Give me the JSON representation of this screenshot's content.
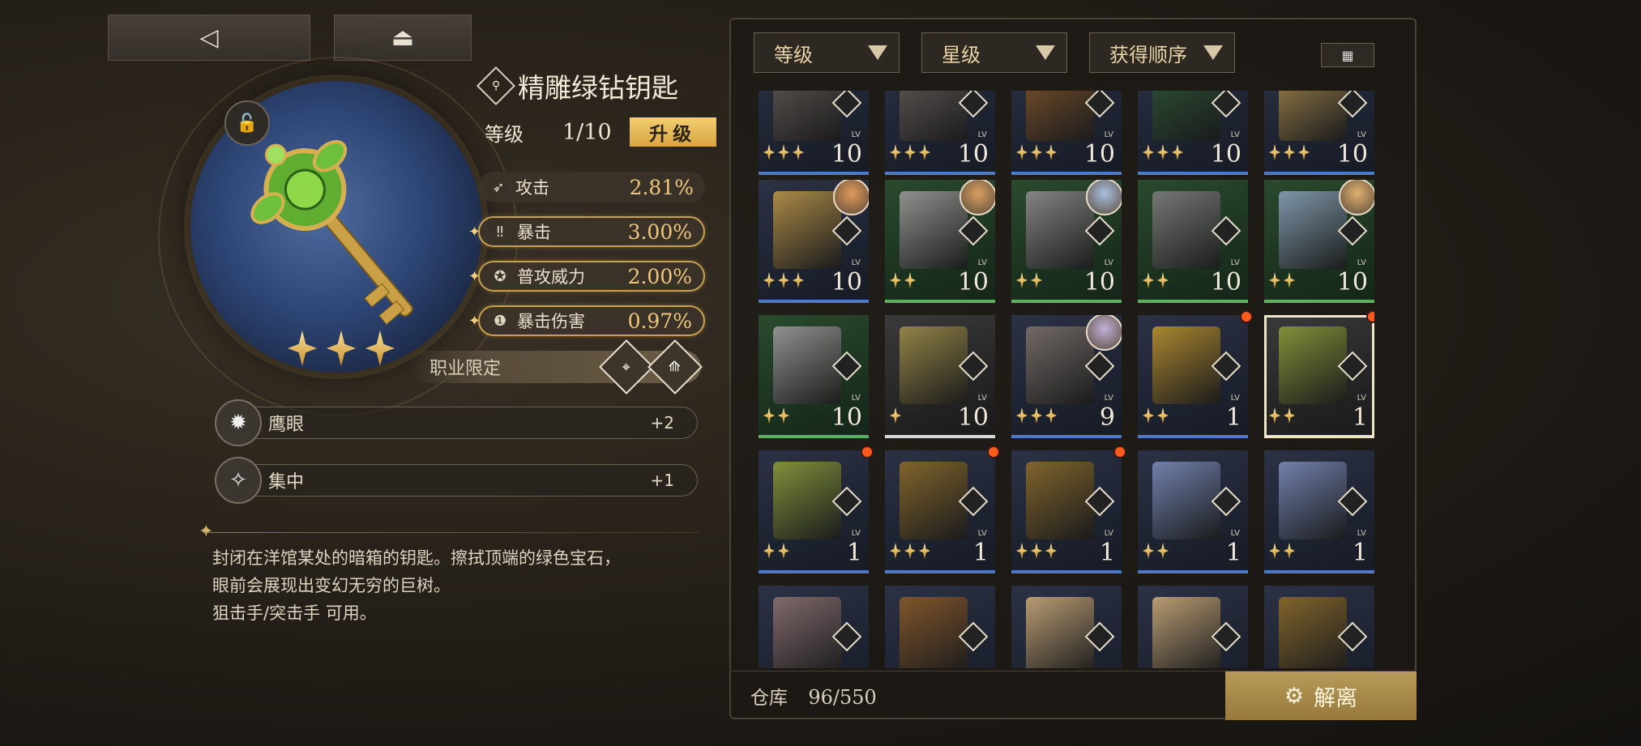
{
  "nav": {
    "back_icon": "◁",
    "home_icon": "⏏"
  },
  "item": {
    "name": "精雕绿钻钥匙",
    "level_label": "等级",
    "level_value": "1/10",
    "upgrade_label": "升级",
    "stars": 3,
    "stats": [
      {
        "icon": "attack-icon",
        "label": "攻击",
        "value": "2.81%",
        "highlight": false
      },
      {
        "icon": "crit-icon",
        "label": "暴击",
        "value": "3.00%",
        "highlight": true
      },
      {
        "icon": "normal-attack-icon",
        "label": "普攻威力",
        "value": "2.00%",
        "highlight": true
      },
      {
        "icon": "crit-damage-icon",
        "label": "暴击伤害",
        "value": "0.97%",
        "highlight": true
      }
    ],
    "class_limit_label": "职业限定",
    "skills": [
      {
        "name": "鹰眼",
        "value": "+2"
      },
      {
        "name": "集中",
        "value": "+1"
      }
    ],
    "description_lines": [
      "封闭在洋馆某处的暗箱的钥匙。擦拭顶端的绿色宝石，",
      "眼前会展现出变幻无穷的巨树。",
      "狙击手/突击手 可用。"
    ]
  },
  "filters": [
    {
      "label": "等级"
    },
    {
      "label": "星级"
    },
    {
      "label": "获得顺序"
    }
  ],
  "inventory": {
    "items": [
      {
        "rarity": "blue",
        "stars": 3,
        "level": "10",
        "art": "#6a5f58",
        "avatar": null,
        "new": false
      },
      {
        "rarity": "blue",
        "stars": 3,
        "level": "10",
        "art": "#6c625c",
        "avatar": null,
        "new": false
      },
      {
        "rarity": "blue",
        "stars": 3,
        "level": "10",
        "art": "#8a5a2a",
        "avatar": null,
        "new": false
      },
      {
        "rarity": "blue",
        "stars": 3,
        "level": "10",
        "art": "#2f5a36",
        "avatar": null,
        "new": false
      },
      {
        "rarity": "blue",
        "stars": 3,
        "level": "10",
        "art": "#b09050",
        "avatar": null,
        "new": false
      },
      {
        "rarity": "blue",
        "stars": 3,
        "level": "10",
        "art": "#b89448",
        "avatar": "#e09a5a",
        "new": false
      },
      {
        "rarity": "green",
        "stars": 2,
        "level": "10",
        "art": "#9a9a9a",
        "avatar": "#d9a060",
        "new": false
      },
      {
        "rarity": "green",
        "stars": 2,
        "level": "10",
        "art": "#8c8c8c",
        "avatar": "#a8c0e0",
        "new": false
      },
      {
        "rarity": "green",
        "stars": 2,
        "level": "10",
        "art": "#7e7e7e",
        "avatar": null,
        "new": false
      },
      {
        "rarity": "green",
        "stars": 2,
        "level": "10",
        "art": "#8aa0b8",
        "avatar": "#e0b070",
        "new": false
      },
      {
        "rarity": "green",
        "stars": 2,
        "level": "10",
        "art": "#9a9a9a",
        "avatar": null,
        "new": false
      },
      {
        "rarity": "white",
        "stars": 1,
        "level": "10",
        "art": "#9c8c4a",
        "avatar": null,
        "new": false
      },
      {
        "rarity": "blue",
        "stars": 3,
        "level": "9",
        "art": "#7a706a",
        "avatar": "#c0b0d8",
        "new": false
      },
      {
        "rarity": "blue",
        "stars": 2,
        "level": "1",
        "art": "#b8902e",
        "avatar": null,
        "new": true
      },
      {
        "rarity": "white",
        "stars": 2,
        "level": "1",
        "art": "#8a9a3a",
        "avatar": null,
        "new": true,
        "selected": true
      },
      {
        "rarity": "blue",
        "stars": 2,
        "level": "1",
        "art": "#8a9a3a",
        "avatar": null,
        "new": true
      },
      {
        "rarity": "blue",
        "stars": 3,
        "level": "1",
        "art": "#8a6a2a",
        "avatar": null,
        "new": true
      },
      {
        "rarity": "blue",
        "stars": 3,
        "level": "1",
        "art": "#8a6a2a",
        "avatar": null,
        "new": true
      },
      {
        "rarity": "blue",
        "stars": 2,
        "level": "1",
        "art": "#7a8ab8",
        "avatar": null,
        "new": false
      },
      {
        "rarity": "blue",
        "stars": 2,
        "level": "1",
        "art": "#7a8ab8",
        "avatar": null,
        "new": false
      },
      {
        "rarity": "blue",
        "stars": 0,
        "level": "",
        "art": "#8a7070",
        "avatar": null,
        "new": false
      },
      {
        "rarity": "blue",
        "stars": 0,
        "level": "",
        "art": "#8a5a2a",
        "avatar": null,
        "new": false
      },
      {
        "rarity": "blue",
        "stars": 0,
        "level": "",
        "art": "#c8a878",
        "avatar": null,
        "new": false
      },
      {
        "rarity": "blue",
        "stars": 0,
        "level": "",
        "art": "#c8a878",
        "avatar": null,
        "new": false
      },
      {
        "rarity": "blue",
        "stars": 0,
        "level": "",
        "art": "#8a6a2a",
        "avatar": null,
        "new": false
      }
    ],
    "lv_tag": "LV"
  },
  "footer": {
    "storage_label": "仓库",
    "storage_count": "96/550",
    "dismantle_label": "解离"
  }
}
